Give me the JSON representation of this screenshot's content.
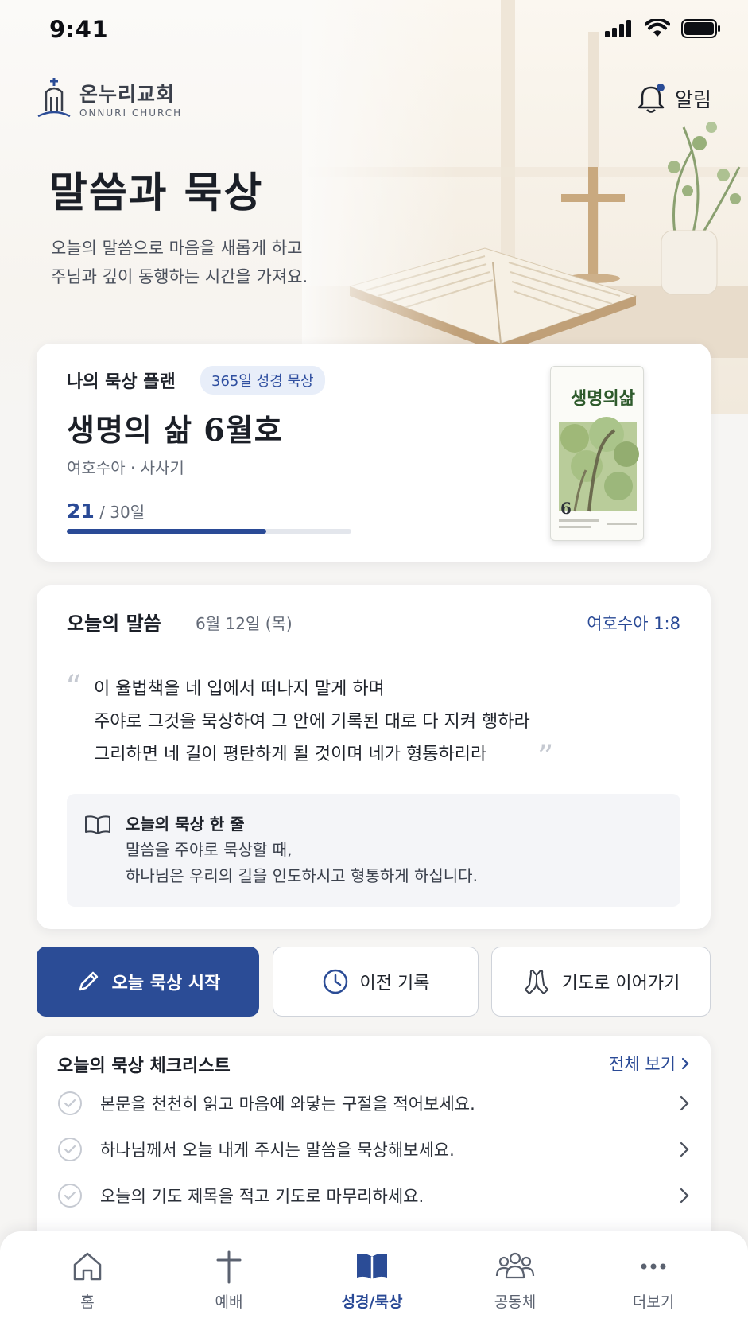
{
  "status": {
    "time": "9:41"
  },
  "header": {
    "logo_ko": "온누리교회",
    "logo_en": "ONNURI CHURCH",
    "alarm_label": "알림"
  },
  "hero": {
    "title": "말씀과 묵상",
    "subtitle_line1": "오늘의 말씀으로 마음을 새롭게 하고",
    "subtitle_line2": "주님과 깊이 동행하는 시간을 가져요."
  },
  "plan": {
    "label": "나의 묵상 플랜",
    "badge": "365일 성경 묵상",
    "title": "생명의 삶 6월호",
    "books": "여호수아 · 사사기",
    "current_day": "21",
    "total_label": "/ 30일",
    "progress": 0.7,
    "cover_title": "생명의삶",
    "cover_issue": "6"
  },
  "word": {
    "heading": "오늘의 말씀",
    "date": "6월 12일 (목)",
    "reference": "여호수아 1:8",
    "verse_line1": "이 율법책을 네 입에서 떠나지 말게 하며",
    "verse_line2": "주야로 그것을 묵상하여 그 안에 기록된 대로 다 지켜 행하라",
    "verse_line3": "그리하면 네 길이 평탄하게 될 것이며 네가 형통하리라",
    "meditation_title": "오늘의 묵상 한 줄",
    "meditation_line1": "말씀을 주야로 묵상할 때,",
    "meditation_line2": "하나님은 우리의 길을 인도하시고 형통하게 하십니다."
  },
  "actions": {
    "start": "오늘 묵상 시작",
    "history": "이전 기록",
    "pray": "기도로 이어가기"
  },
  "checklist": {
    "heading": "오늘의 묵상 체크리스트",
    "view_all": "전체 보기",
    "items": [
      "본문을 천천히 읽고 마음에 와닿는 구절을 적어보세요.",
      "하나님께서 오늘 내게 주시는 말씀을 묵상해보세요.",
      "오늘의 기도 제목을 적고 기도로 마무리하세요."
    ]
  },
  "tabbar": {
    "items": [
      "홈",
      "예배",
      "성경/묵상",
      "공동체",
      "더보기"
    ],
    "active": "성경/묵상"
  },
  "colors": {
    "accent": "#2b4c96",
    "badge_bg": "#e8eef9"
  }
}
